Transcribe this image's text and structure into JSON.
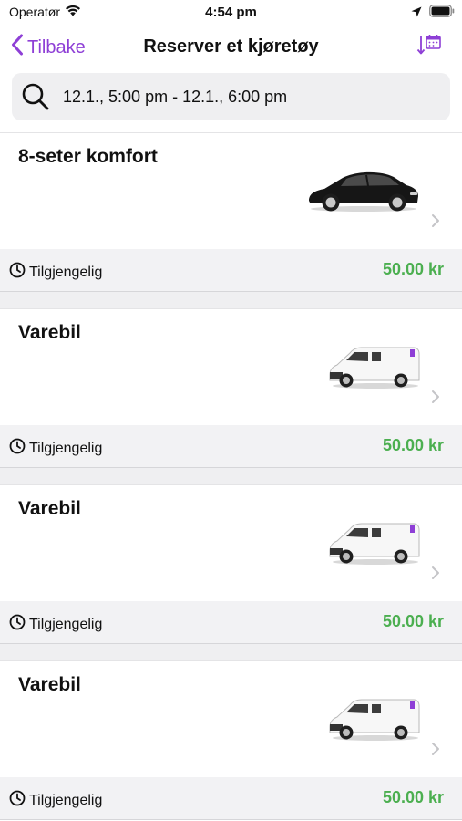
{
  "status_bar": {
    "carrier": "Operatør",
    "time": "4:54 pm"
  },
  "nav": {
    "back_label": "Tilbake",
    "title": "Reserver et kjøretøy",
    "sort_icon": "calendar-sort-icon"
  },
  "search": {
    "value": "12.1., 5:00 pm - 12.1., 6:00 pm"
  },
  "colors": {
    "accent": "#8e3fd6",
    "price": "#4caf50"
  },
  "vehicles": [
    {
      "name": "8-seter komfort",
      "image": "car-image",
      "availability": "Tilgjengelig",
      "price": "50.00 kr"
    },
    {
      "name": "Varebil",
      "image": "van-image",
      "availability": "Tilgjengelig",
      "price": "50.00 kr"
    },
    {
      "name": "Varebil",
      "image": "van-image",
      "availability": "Tilgjengelig",
      "price": "50.00 kr"
    },
    {
      "name": "Varebil",
      "image": "van-image",
      "availability": "Tilgjengelig",
      "price": "50.00 kr"
    }
  ]
}
